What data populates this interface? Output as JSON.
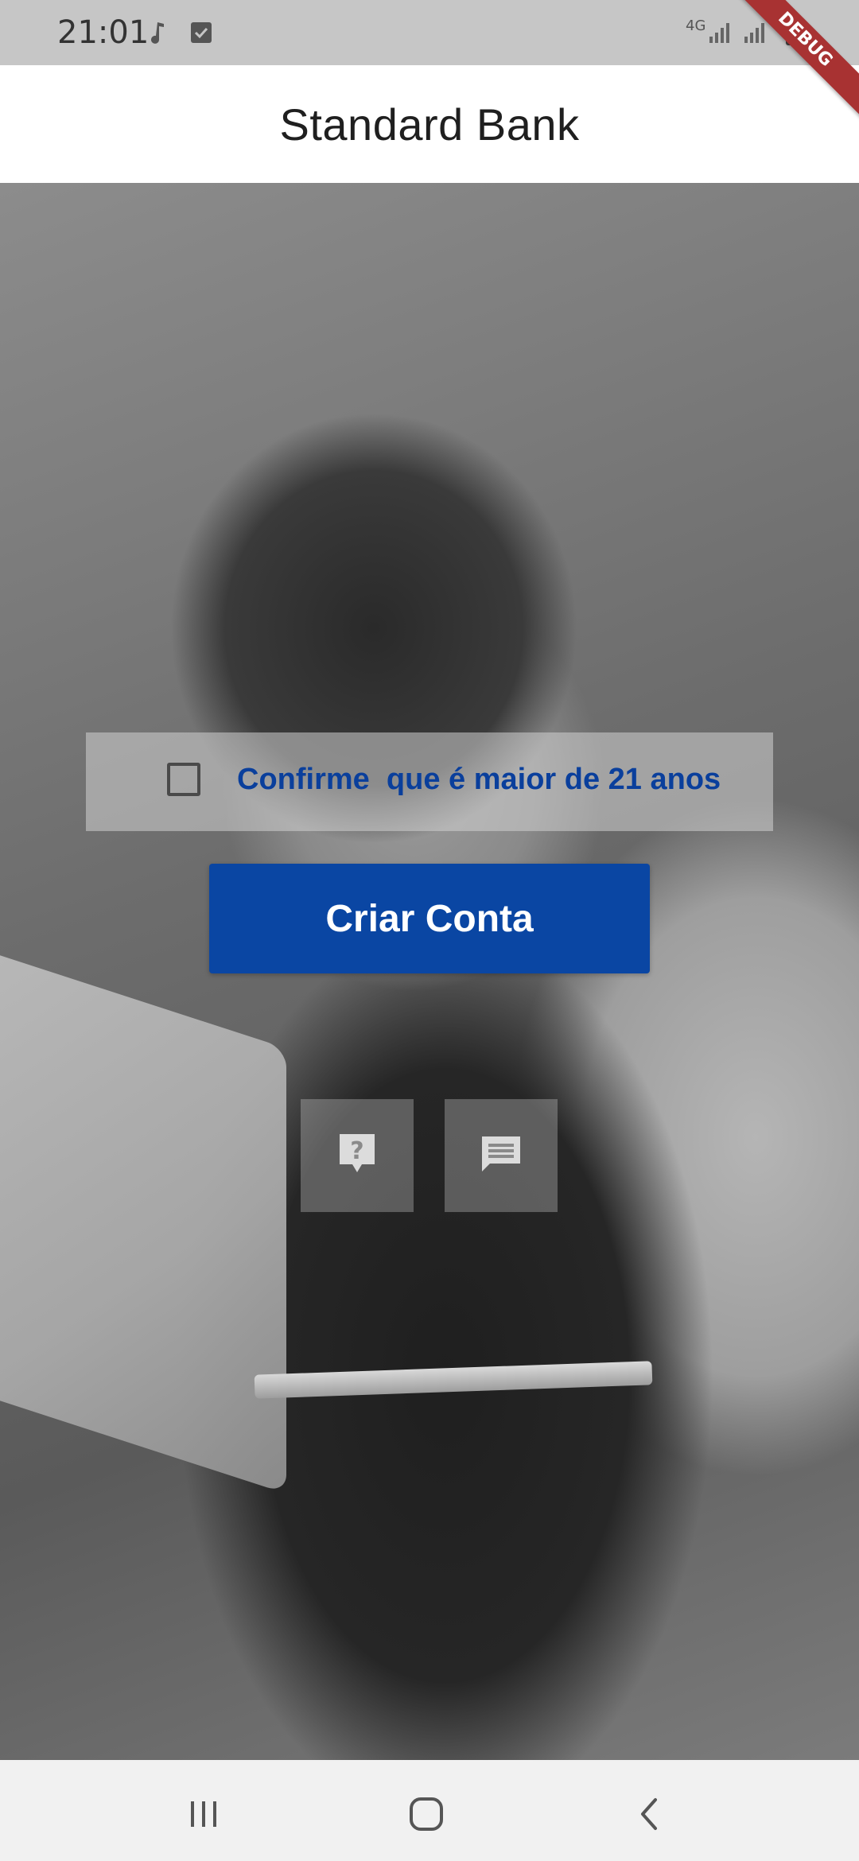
{
  "status_bar": {
    "time": "21:01",
    "network": "4G",
    "icons": [
      "music-note-icon",
      "checkbox-notification-icon",
      "signal-icon",
      "signal-icon",
      "battery-icon"
    ]
  },
  "debug_banner": "DEBUG",
  "app_bar": {
    "title": "Standard Bank"
  },
  "age_confirmation": {
    "label": "Confirme  que é maior de 21 anos",
    "checked": false
  },
  "primary_button": {
    "label": "Criar Conta"
  },
  "help_tiles": [
    {
      "icon": "help-question-icon"
    },
    {
      "icon": "chat-message-icon"
    }
  ],
  "nav_bar": {
    "buttons": [
      "recent-apps-icon",
      "home-icon",
      "back-icon"
    ]
  },
  "colors": {
    "accent": "#0a46a3",
    "label_text": "#0a3f9c",
    "app_bar_bg": "#ffffff",
    "status_bar_bg": "#c6c6c6",
    "nav_bar_bg": "#f1f1f1"
  }
}
